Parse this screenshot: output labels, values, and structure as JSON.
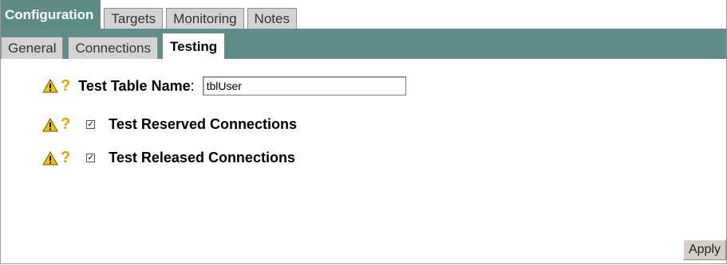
{
  "tabs_primary": [
    {
      "label": "Configuration",
      "active": true
    },
    {
      "label": "Targets",
      "active": false
    },
    {
      "label": "Monitoring",
      "active": false
    },
    {
      "label": "Notes",
      "active": false
    }
  ],
  "tabs_secondary": [
    {
      "label": "General",
      "active": false
    },
    {
      "label": "Connections",
      "active": false
    },
    {
      "label": "Testing",
      "active": true
    }
  ],
  "form": {
    "test_table_name": {
      "label": "Test Table Name",
      "colon": ":",
      "value": "tblUser"
    },
    "test_reserved": {
      "label": "Test Reserved Connections",
      "checked": true,
      "mark": "✓"
    },
    "test_released": {
      "label": "Test Released Connections",
      "checked": true,
      "mark": "✓"
    },
    "help_glyph": "?"
  },
  "buttons": {
    "apply_label": "Apply"
  },
  "colors": {
    "accent": "#5f8d89",
    "tab_inactive": "#d3d3d3",
    "help": "#e6a100",
    "warning": "#f2c200"
  },
  "icons": {
    "warning": "warning-icon",
    "help": "help-icon",
    "checkbox": "checkbox-icon"
  }
}
